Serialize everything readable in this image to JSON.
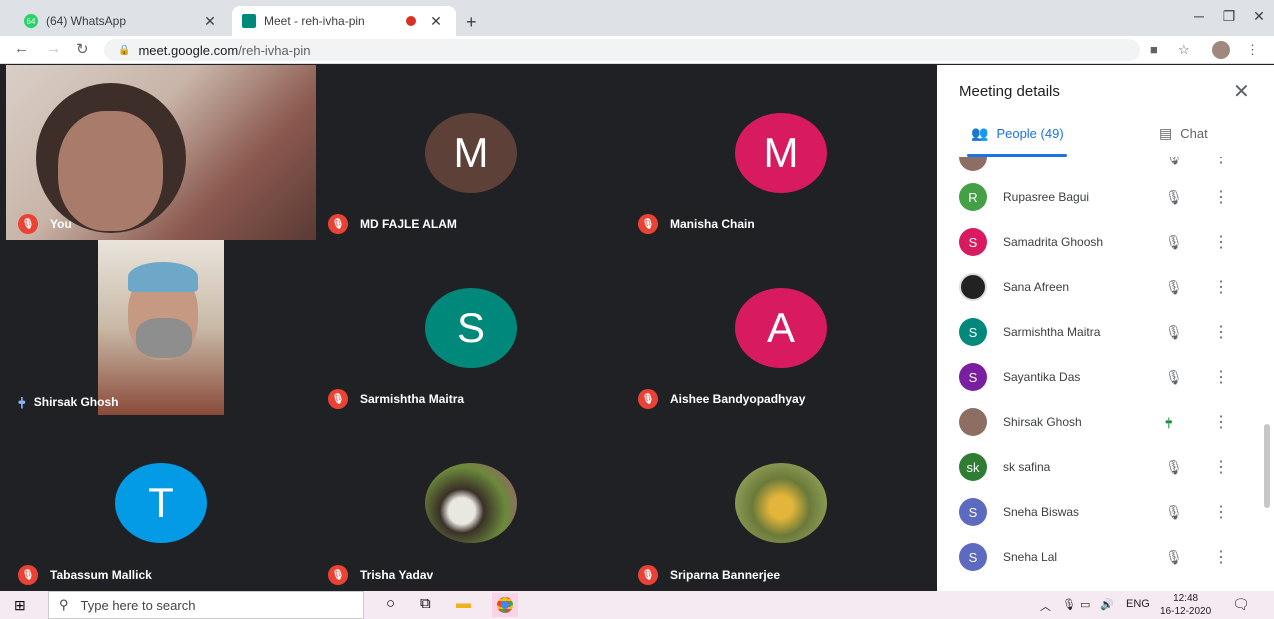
{
  "browser": {
    "tabs": [
      {
        "label": "(64) WhatsApp",
        "favicon_text": "64",
        "favicon_color": "#25d366"
      },
      {
        "label": "Meet - reh-ivha-pin",
        "favicon_color": "#00897b"
      }
    ],
    "url_host": "meet.google.com",
    "url_path": "/reh-ivha-pin"
  },
  "video_tiles": [
    {
      "name": "You",
      "state": "muted",
      "type": "video",
      "color": "#c9a9a0"
    },
    {
      "name": "MD FAJLE ALAM",
      "state": "muted",
      "type": "initial",
      "initial": "M",
      "color": "#5d4037"
    },
    {
      "name": "Manisha Chain",
      "state": "muted",
      "type": "initial",
      "initial": "M",
      "color": "#d81b60"
    },
    {
      "name": "Shirsak Ghosh",
      "state": "speaking",
      "type": "video",
      "color": "#7a6a5e"
    },
    {
      "name": "Sarmishtha Maitra",
      "state": "muted",
      "type": "initial",
      "initial": "S",
      "color": "#00897b"
    },
    {
      "name": "Aishee Bandyopadhyay",
      "state": "muted",
      "type": "initial",
      "initial": "A",
      "color": "#d81b60"
    },
    {
      "name": "Tabassum Mallick",
      "state": "muted",
      "type": "initial",
      "initial": "T",
      "color": "#039be5"
    },
    {
      "name": "Trisha Yadav",
      "state": "muted",
      "type": "photo",
      "color": "#4e5a3a"
    },
    {
      "name": "Sriparna Bannerjee",
      "state": "muted",
      "type": "photo",
      "color": "#8a9a3a"
    }
  ],
  "panel": {
    "title": "Meeting details",
    "people_tab": "People (49)",
    "chat_tab": "Chat",
    "people": [
      {
        "name": "Rupasree Bagui",
        "initial": "R",
        "color": "#43a047",
        "state": "muted"
      },
      {
        "name": "Samadrita Ghoosh",
        "initial": "S",
        "color": "#d81b60",
        "state": "muted"
      },
      {
        "name": "Sana Afreen",
        "initial": "",
        "color": "#222222",
        "state": "muted"
      },
      {
        "name": "Sarmishtha Maitra",
        "initial": "S",
        "color": "#00897b",
        "state": "muted"
      },
      {
        "name": "Sayantika Das",
        "initial": "S",
        "color": "#7b1fa2",
        "state": "muted"
      },
      {
        "name": "Shirsak Ghosh",
        "initial": "",
        "color": "#8d6e63",
        "state": "speaking"
      },
      {
        "name": "sk safina",
        "initial": "sk",
        "color": "#2e7d32",
        "state": "muted"
      },
      {
        "name": "Sneha Biswas",
        "initial": "S",
        "color": "#5c6bc0",
        "state": "muted"
      },
      {
        "name": "Sneha Lal",
        "initial": "S",
        "color": "#5c6bc0",
        "state": "muted"
      }
    ]
  },
  "taskbar": {
    "search_placeholder": "Type here to search",
    "lang": "ENG",
    "time": "12:48",
    "date": "16-12-2020"
  }
}
